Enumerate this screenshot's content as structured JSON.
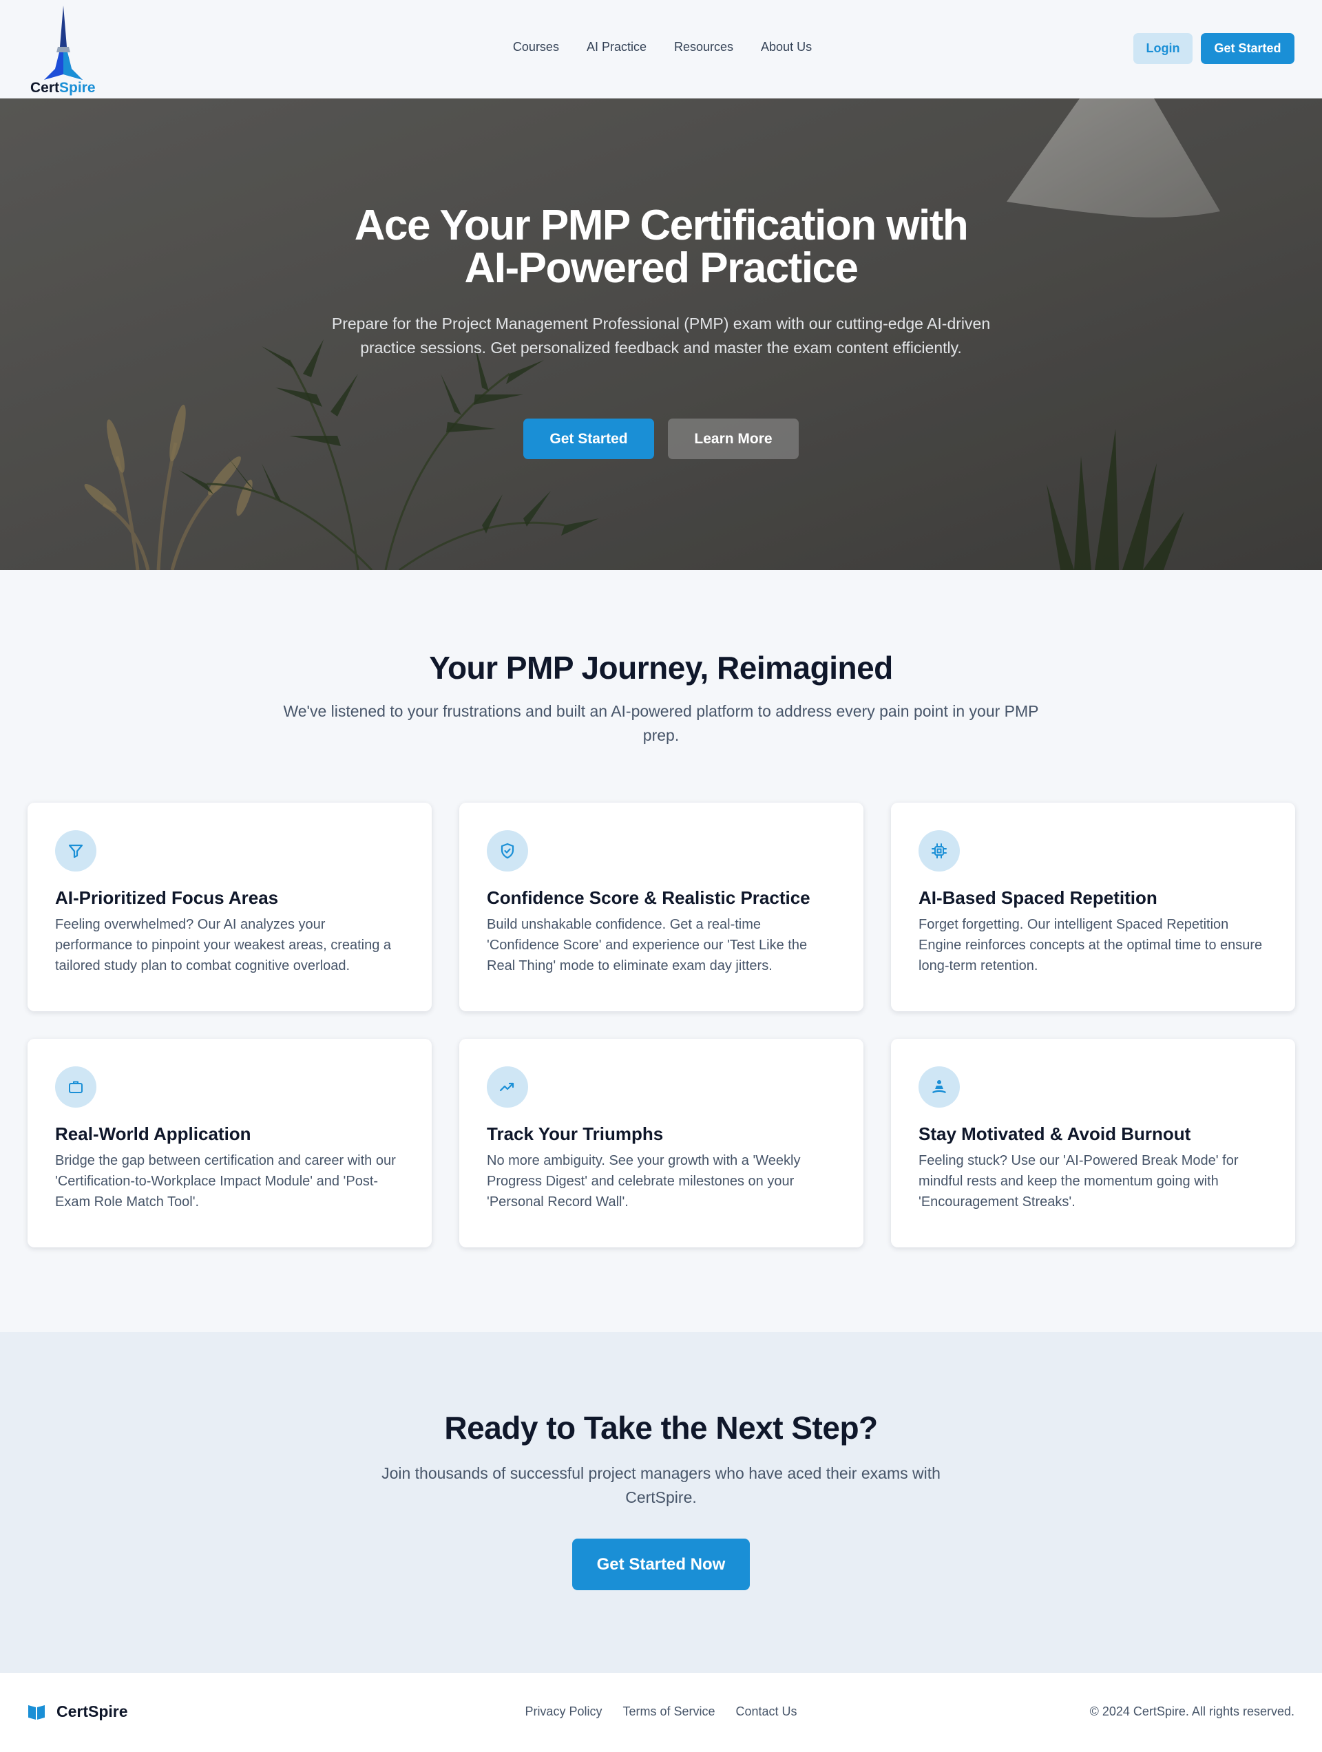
{
  "brand": {
    "name_part1": "Cert",
    "name_part2": "Spire",
    "footer_name": "CertSpire"
  },
  "nav": {
    "links": [
      "Courses",
      "AI Practice",
      "Resources",
      "About Us"
    ],
    "login_label": "Login",
    "get_started_label": "Get Started"
  },
  "hero": {
    "title_line1": "Ace Your PMP Certification with",
    "title_line2": "AI-Powered Practice",
    "subtitle": "Prepare for the Project Management Professional (PMP) exam with our cutting-edge AI-driven practice sessions. Get personalized feedback and master the exam content efficiently.",
    "primary_button": "Get Started",
    "secondary_button": "Learn More"
  },
  "features": {
    "title": "Your PMP Journey, Reimagined",
    "subtitle": "We've listened to your frustrations and built an AI-powered platform to address every pain point in your PMP prep.",
    "cards": [
      {
        "icon": "filter-icon",
        "title": "AI-Prioritized Focus Areas",
        "description": "Feeling overwhelmed? Our AI analyzes your performance to pinpoint your weakest areas, creating a tailored study plan to combat cognitive overload."
      },
      {
        "icon": "shield-check-icon",
        "title": "Confidence Score & Realistic Practice",
        "description": "Build unshakable confidence. Get a real-time 'Confidence Score' and experience our 'Test Like the Real Thing' mode to eliminate exam day jitters."
      },
      {
        "icon": "cpu-chip-icon",
        "title": "AI-Based Spaced Repetition",
        "description": "Forget forgetting. Our intelligent Spaced Repetition Engine reinforces concepts at the optimal time to ensure long-term retention."
      },
      {
        "icon": "briefcase-icon",
        "title": "Real-World Application",
        "description": "Bridge the gap between certification and career with our 'Certification-to-Workplace Impact Module' and 'Post-Exam Role Match Tool'."
      },
      {
        "icon": "trending-up-icon",
        "title": "Track Your Triumphs",
        "description": "No more ambiguity. See your growth with a 'Weekly Progress Digest' and celebrate milestones on your 'Personal Record Wall'."
      },
      {
        "icon": "meditation-icon",
        "title": "Stay Motivated & Avoid Burnout",
        "description": "Feeling stuck? Use our 'AI-Powered Break Mode' for mindful rests and keep the momentum going with 'Encouragement Streaks'."
      }
    ]
  },
  "cta": {
    "title": "Ready to Take the Next Step?",
    "subtitle": "Join thousands of successful project managers who have aced their exams with CertSpire.",
    "button": "Get Started Now"
  },
  "footer": {
    "links": [
      "Privacy Policy",
      "Terms of Service",
      "Contact Us"
    ],
    "copyright": "© 2024 CertSpire. All rights reserved."
  },
  "colors": {
    "accent": "#1a8fd6",
    "accent_soft": "#cfe6f5",
    "heading": "#0f172a",
    "body": "#475569"
  }
}
